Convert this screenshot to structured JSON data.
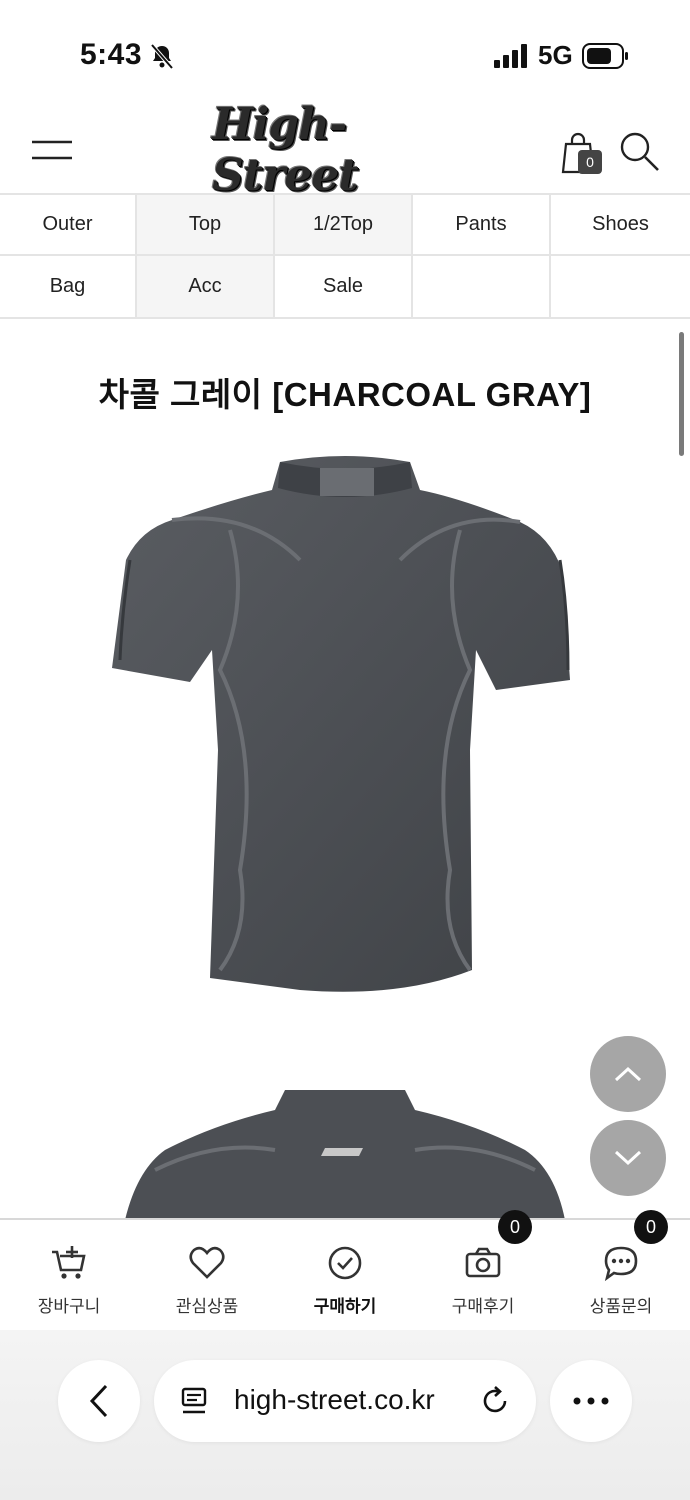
{
  "status_bar": {
    "time": "5:43",
    "network": "5G",
    "icons": [
      "bell-slash-icon",
      "signal-icon",
      "battery-icon"
    ]
  },
  "header": {
    "logo_text": "High-Street",
    "cart_count": "0",
    "icons": [
      "menu-icon",
      "shopping-bag-icon",
      "search-icon"
    ]
  },
  "categories": [
    {
      "label": "Outer"
    },
    {
      "label": "Top"
    },
    {
      "label": "1/2Top"
    },
    {
      "label": "Pants"
    },
    {
      "label": "Shoes"
    },
    {
      "label": "Bag"
    },
    {
      "label": "Acc"
    },
    {
      "label": "Sale"
    },
    {
      "label": ""
    },
    {
      "label": ""
    }
  ],
  "product": {
    "title": "차콜 그레이 [CHARCOAL GRAY]",
    "shirt_color": "#4c4f54"
  },
  "action_bar": {
    "items": [
      {
        "label": "장바구니",
        "icon": "cart-plus-icon"
      },
      {
        "label": "관심상품",
        "icon": "heart-icon"
      },
      {
        "label": "구매하기",
        "icon": "check-circle-icon"
      },
      {
        "label": "구매후기",
        "icon": "camera-icon",
        "badge": "0"
      },
      {
        "label": "상품문의",
        "icon": "chat-bubble-icon",
        "badge": "0"
      }
    ]
  },
  "browser": {
    "url": "high-street.co.kr",
    "icons": [
      "back-chevron-icon",
      "page-icon",
      "reload-icon",
      "more-icon"
    ]
  },
  "colors": {
    "scroll_button": "#a6a6a6",
    "badge_bg": "#111111",
    "grid_border": "#e4e4e4"
  }
}
